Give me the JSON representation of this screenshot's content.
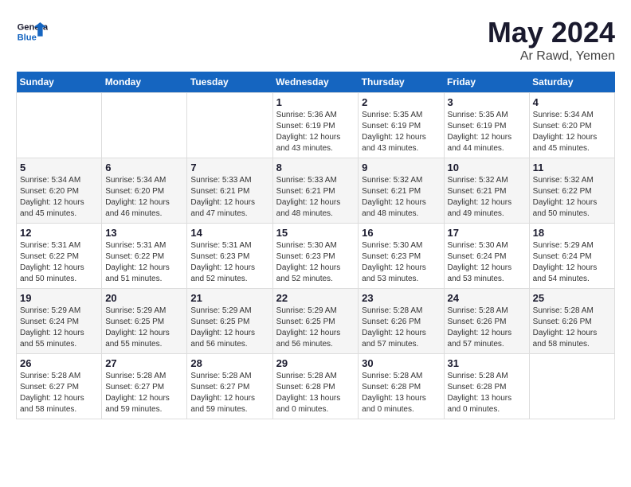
{
  "logo": {
    "line1": "General",
    "line2": "Blue"
  },
  "title": "May 2024",
  "location": "Ar Rawd, Yemen",
  "days_header": [
    "Sunday",
    "Monday",
    "Tuesday",
    "Wednesday",
    "Thursday",
    "Friday",
    "Saturday"
  ],
  "weeks": [
    [
      {
        "day": "",
        "sunrise": "",
        "sunset": "",
        "daylight": ""
      },
      {
        "day": "",
        "sunrise": "",
        "sunset": "",
        "daylight": ""
      },
      {
        "day": "",
        "sunrise": "",
        "sunset": "",
        "daylight": ""
      },
      {
        "day": "1",
        "sunrise": "Sunrise: 5:36 AM",
        "sunset": "Sunset: 6:19 PM",
        "daylight": "Daylight: 12 hours and 43 minutes."
      },
      {
        "day": "2",
        "sunrise": "Sunrise: 5:35 AM",
        "sunset": "Sunset: 6:19 PM",
        "daylight": "Daylight: 12 hours and 43 minutes."
      },
      {
        "day": "3",
        "sunrise": "Sunrise: 5:35 AM",
        "sunset": "Sunset: 6:19 PM",
        "daylight": "Daylight: 12 hours and 44 minutes."
      },
      {
        "day": "4",
        "sunrise": "Sunrise: 5:34 AM",
        "sunset": "Sunset: 6:20 PM",
        "daylight": "Daylight: 12 hours and 45 minutes."
      }
    ],
    [
      {
        "day": "5",
        "sunrise": "Sunrise: 5:34 AM",
        "sunset": "Sunset: 6:20 PM",
        "daylight": "Daylight: 12 hours and 45 minutes."
      },
      {
        "day": "6",
        "sunrise": "Sunrise: 5:34 AM",
        "sunset": "Sunset: 6:20 PM",
        "daylight": "Daylight: 12 hours and 46 minutes."
      },
      {
        "day": "7",
        "sunrise": "Sunrise: 5:33 AM",
        "sunset": "Sunset: 6:21 PM",
        "daylight": "Daylight: 12 hours and 47 minutes."
      },
      {
        "day": "8",
        "sunrise": "Sunrise: 5:33 AM",
        "sunset": "Sunset: 6:21 PM",
        "daylight": "Daylight: 12 hours and 48 minutes."
      },
      {
        "day": "9",
        "sunrise": "Sunrise: 5:32 AM",
        "sunset": "Sunset: 6:21 PM",
        "daylight": "Daylight: 12 hours and 48 minutes."
      },
      {
        "day": "10",
        "sunrise": "Sunrise: 5:32 AM",
        "sunset": "Sunset: 6:21 PM",
        "daylight": "Daylight: 12 hours and 49 minutes."
      },
      {
        "day": "11",
        "sunrise": "Sunrise: 5:32 AM",
        "sunset": "Sunset: 6:22 PM",
        "daylight": "Daylight: 12 hours and 50 minutes."
      }
    ],
    [
      {
        "day": "12",
        "sunrise": "Sunrise: 5:31 AM",
        "sunset": "Sunset: 6:22 PM",
        "daylight": "Daylight: 12 hours and 50 minutes."
      },
      {
        "day": "13",
        "sunrise": "Sunrise: 5:31 AM",
        "sunset": "Sunset: 6:22 PM",
        "daylight": "Daylight: 12 hours and 51 minutes."
      },
      {
        "day": "14",
        "sunrise": "Sunrise: 5:31 AM",
        "sunset": "Sunset: 6:23 PM",
        "daylight": "Daylight: 12 hours and 52 minutes."
      },
      {
        "day": "15",
        "sunrise": "Sunrise: 5:30 AM",
        "sunset": "Sunset: 6:23 PM",
        "daylight": "Daylight: 12 hours and 52 minutes."
      },
      {
        "day": "16",
        "sunrise": "Sunrise: 5:30 AM",
        "sunset": "Sunset: 6:23 PM",
        "daylight": "Daylight: 12 hours and 53 minutes."
      },
      {
        "day": "17",
        "sunrise": "Sunrise: 5:30 AM",
        "sunset": "Sunset: 6:24 PM",
        "daylight": "Daylight: 12 hours and 53 minutes."
      },
      {
        "day": "18",
        "sunrise": "Sunrise: 5:29 AM",
        "sunset": "Sunset: 6:24 PM",
        "daylight": "Daylight: 12 hours and 54 minutes."
      }
    ],
    [
      {
        "day": "19",
        "sunrise": "Sunrise: 5:29 AM",
        "sunset": "Sunset: 6:24 PM",
        "daylight": "Daylight: 12 hours and 55 minutes."
      },
      {
        "day": "20",
        "sunrise": "Sunrise: 5:29 AM",
        "sunset": "Sunset: 6:25 PM",
        "daylight": "Daylight: 12 hours and 55 minutes."
      },
      {
        "day": "21",
        "sunrise": "Sunrise: 5:29 AM",
        "sunset": "Sunset: 6:25 PM",
        "daylight": "Daylight: 12 hours and 56 minutes."
      },
      {
        "day": "22",
        "sunrise": "Sunrise: 5:29 AM",
        "sunset": "Sunset: 6:25 PM",
        "daylight": "Daylight: 12 hours and 56 minutes."
      },
      {
        "day": "23",
        "sunrise": "Sunrise: 5:28 AM",
        "sunset": "Sunset: 6:26 PM",
        "daylight": "Daylight: 12 hours and 57 minutes."
      },
      {
        "day": "24",
        "sunrise": "Sunrise: 5:28 AM",
        "sunset": "Sunset: 6:26 PM",
        "daylight": "Daylight: 12 hours and 57 minutes."
      },
      {
        "day": "25",
        "sunrise": "Sunrise: 5:28 AM",
        "sunset": "Sunset: 6:26 PM",
        "daylight": "Daylight: 12 hours and 58 minutes."
      }
    ],
    [
      {
        "day": "26",
        "sunrise": "Sunrise: 5:28 AM",
        "sunset": "Sunset: 6:27 PM",
        "daylight": "Daylight: 12 hours and 58 minutes."
      },
      {
        "day": "27",
        "sunrise": "Sunrise: 5:28 AM",
        "sunset": "Sunset: 6:27 PM",
        "daylight": "Daylight: 12 hours and 59 minutes."
      },
      {
        "day": "28",
        "sunrise": "Sunrise: 5:28 AM",
        "sunset": "Sunset: 6:27 PM",
        "daylight": "Daylight: 12 hours and 59 minutes."
      },
      {
        "day": "29",
        "sunrise": "Sunrise: 5:28 AM",
        "sunset": "Sunset: 6:28 PM",
        "daylight": "Daylight: 13 hours and 0 minutes."
      },
      {
        "day": "30",
        "sunrise": "Sunrise: 5:28 AM",
        "sunset": "Sunset: 6:28 PM",
        "daylight": "Daylight: 13 hours and 0 minutes."
      },
      {
        "day": "31",
        "sunrise": "Sunrise: 5:28 AM",
        "sunset": "Sunset: 6:28 PM",
        "daylight": "Daylight: 13 hours and 0 minutes."
      },
      {
        "day": "",
        "sunrise": "",
        "sunset": "",
        "daylight": ""
      }
    ]
  ]
}
